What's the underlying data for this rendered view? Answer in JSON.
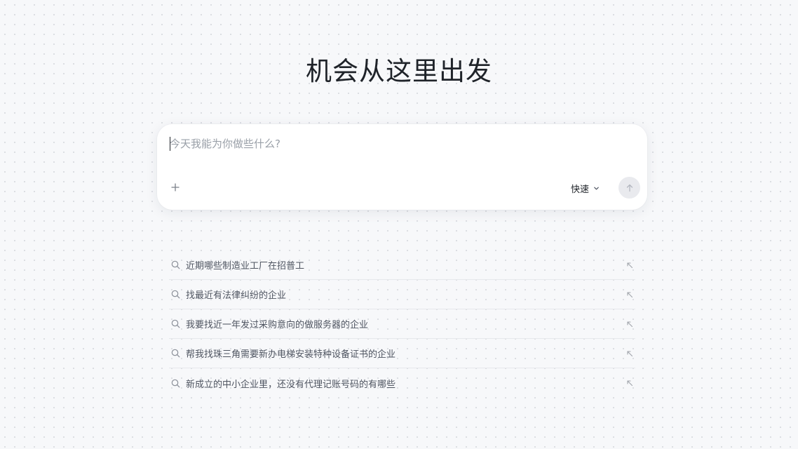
{
  "page": {
    "title": "机会从这里出发"
  },
  "chat": {
    "placeholder": "今天我能为你做些什么?",
    "value": "",
    "mode_label": "快速",
    "plus_icon": "plus-icon",
    "mode_icon": "chevron-down-icon",
    "send_icon": "arrow-up-icon"
  },
  "suggestions": {
    "icon": "search-icon",
    "action_icon": "arrow-up-left-icon",
    "items": [
      {
        "label": "近期哪些制造业工厂在招普工"
      },
      {
        "label": "找最近有法律纠纷的企业"
      },
      {
        "label": "我要找近一年发过采购意向的做服务器的企业"
      },
      {
        "label": "帮我找珠三角需要新办电梯安装特种设备证书的企业"
      },
      {
        "label": "新成立的中小企业里，还没有代理记账号码的有哪些"
      }
    ]
  },
  "colors": {
    "background": "#f7f8fa",
    "card": "#ffffff",
    "text": "#1f2329",
    "muted": "#9aa0a8",
    "send_button_bg": "#e9eaee"
  }
}
